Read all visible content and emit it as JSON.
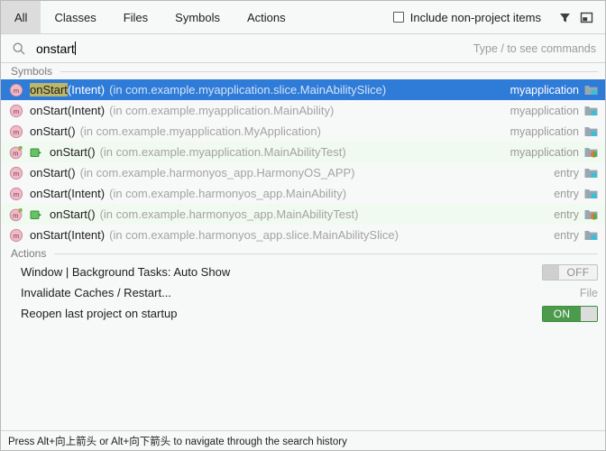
{
  "tabs": [
    {
      "label": "All",
      "selected": true
    },
    {
      "label": "Classes",
      "selected": false
    },
    {
      "label": "Files",
      "selected": false
    },
    {
      "label": "Symbols",
      "selected": false
    },
    {
      "label": "Actions",
      "selected": false
    }
  ],
  "toolbar": {
    "include_non_project_label": "Include non-project items",
    "include_non_project_checked": false,
    "filter_icon": "filter-funnel-icon",
    "preview_icon": "preview-panel-icon"
  },
  "search": {
    "icon": "search-icon",
    "value": "onstart",
    "hint": "Type / to see commands"
  },
  "groups": {
    "symbols_header": "Symbols",
    "actions_header": "Actions"
  },
  "symbols": [
    {
      "icon": "method-icon",
      "name": "onStart",
      "highlight": "onStart",
      "signature": "(Intent)",
      "location": "(in com.example.myapplication.slice.MainAbilitySlice)",
      "module": "myapplication",
      "module_icon": "module-folder-icon",
      "selected": true,
      "test": false
    },
    {
      "icon": "method-icon",
      "name": "onStart",
      "signature": "(Intent)",
      "location": "(in com.example.myapplication.MainAbility)",
      "module": "myapplication",
      "module_icon": "module-folder-icon",
      "selected": false,
      "test": false
    },
    {
      "icon": "method-icon",
      "name": "onStart",
      "signature": "()",
      "location": "(in com.example.myapplication.MyApplication)",
      "module": "myapplication",
      "module_icon": "module-folder-icon",
      "selected": false,
      "test": false
    },
    {
      "icon": "method-test-icon",
      "gutter_icon": "run-test-icon",
      "name": "onStart",
      "signature": "()",
      "location": "(in com.example.myapplication.MainAbilityTest)",
      "module": "myapplication",
      "module_icon": "module-test-folder-icon",
      "selected": false,
      "test": true
    },
    {
      "icon": "method-icon",
      "name": "onStart",
      "signature": "()",
      "location": "(in com.example.harmonyos_app.HarmonyOS_APP)",
      "module": "entry",
      "module_icon": "module-folder-icon",
      "selected": false,
      "test": false
    },
    {
      "icon": "method-icon",
      "name": "onStart",
      "signature": "(Intent)",
      "location": "(in com.example.harmonyos_app.MainAbility)",
      "module": "entry",
      "module_icon": "module-folder-icon",
      "selected": false,
      "test": false
    },
    {
      "icon": "method-test-icon",
      "gutter_icon": "run-test-icon",
      "name": "onStart",
      "signature": "()",
      "location": "(in com.example.harmonyos_app.MainAbilityTest)",
      "module": "entry",
      "module_icon": "module-test-folder-icon",
      "selected": false,
      "test": true
    },
    {
      "icon": "method-icon",
      "name": "onStart",
      "signature": "(Intent)",
      "location": "(in com.example.harmonyos_app.slice.MainAbilitySlice)",
      "module": "entry",
      "module_icon": "module-folder-icon",
      "selected": false,
      "test": false
    }
  ],
  "actions": [
    {
      "label": "Window | Background Tasks: Auto Show",
      "control": "toggle",
      "state": "OFF"
    },
    {
      "label": "Invalidate Caches / Restart...",
      "control": "text",
      "state": "File"
    },
    {
      "label": "Reopen last project on startup",
      "control": "toggle",
      "state": "ON"
    }
  ],
  "statusbar": {
    "text": "Press Alt+向上箭头 or Alt+向下箭头 to navigate through the search history"
  },
  "colors": {
    "selection_blue": "#2f7bd8",
    "match_highlight": "#bdb76b",
    "test_row_green": "#f1faf0",
    "toggle_on_green": "#4c9a4c",
    "background": "#f7f8f8"
  }
}
